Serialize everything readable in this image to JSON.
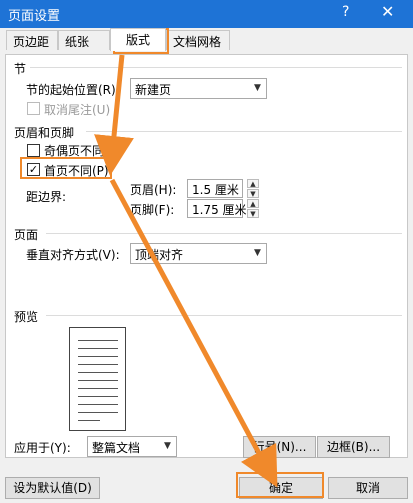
{
  "window": {
    "title": "页面设置",
    "help": "?",
    "close": "✕"
  },
  "tabs": [
    {
      "label": "页边距"
    },
    {
      "label": "纸张"
    },
    {
      "label": "版式"
    },
    {
      "label": "文档网格"
    }
  ],
  "section_jie": {
    "heading": "节",
    "start_label": "节的起始位置(R):",
    "start_value": "新建页",
    "suppress_endnotes_label": "取消尾注(U)"
  },
  "header_footer": {
    "heading": "页眉和页脚",
    "odd_even_label": "奇偶页不同(O)",
    "first_page_label": "首页不同(P)",
    "first_page_checked": "✓",
    "from_edge_label": "距边界:",
    "header_label": "页眉(H):",
    "header_value": "1.5 厘米",
    "footer_label": "页脚(F):",
    "footer_value": "1.75 厘米"
  },
  "page": {
    "heading": "页面",
    "valign_label": "垂直对齐方式(V):",
    "valign_value": "顶端对齐"
  },
  "preview": {
    "heading": "预览"
  },
  "apply": {
    "label": "应用于(Y):",
    "value": "整篇文档"
  },
  "buttons": {
    "line_numbers": "行号(N)...",
    "borders": "边框(B)...",
    "set_default": "设为默认值(D)",
    "ok": "确定",
    "cancel": "取消"
  },
  "colors": {
    "titlebar": "#1e73d6",
    "highlight": "#f0892b"
  }
}
